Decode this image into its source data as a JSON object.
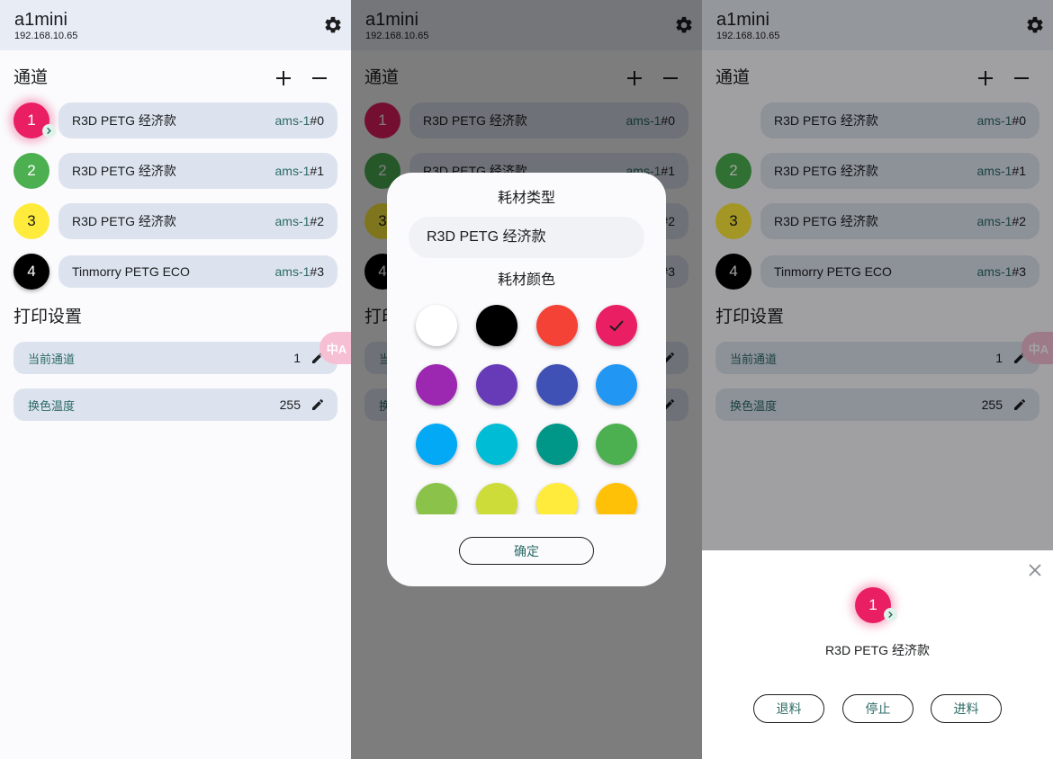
{
  "app": {
    "title": "a1mini",
    "ip": "192.168.10.65"
  },
  "channels": {
    "title": "通道",
    "items": [
      {
        "num": "1",
        "name": "R3D PETG 经济款",
        "slot_prefix": "ams-1",
        "slot_index": "#0",
        "color": "#e91e63"
      },
      {
        "num": "2",
        "name": "R3D PETG 经济款",
        "slot_prefix": "ams-1",
        "slot_index": "#1",
        "color": "#4caf50"
      },
      {
        "num": "3",
        "name": "R3D PETG 经济款",
        "slot_prefix": "ams-1",
        "slot_index": "#2",
        "color": "#ffeb3b"
      },
      {
        "num": "4",
        "name": "Tinmorry PETG ECO",
        "slot_prefix": "ams-1",
        "slot_index": "#3",
        "color": "#000000"
      }
    ]
  },
  "print_settings": {
    "title": "打印设置",
    "items": [
      {
        "label": "当前通道",
        "value": "1"
      },
      {
        "label": "换色温度",
        "value": "255"
      }
    ]
  },
  "translate_badge": "中A",
  "dialog": {
    "type_title": "耗材类型",
    "type_value": "R3D PETG 经济款",
    "color_title": "耗材颜色",
    "swatches": [
      "#ffffff",
      "#000000",
      "#f44336",
      "#e91e63",
      "#9c27b0",
      "#673ab7",
      "#3f51b5",
      "#2196f3",
      "#03a9f4",
      "#00bcd4",
      "#009688",
      "#4caf50",
      "#8bc34a",
      "#cddc39",
      "#ffeb3b",
      "#ffc107"
    ],
    "selected_swatch": "#e91e63",
    "ok_label": "确定"
  },
  "sheet": {
    "num": "1",
    "name": "R3D PETG 经济款",
    "buttons": [
      "退料",
      "停止",
      "进料"
    ]
  }
}
